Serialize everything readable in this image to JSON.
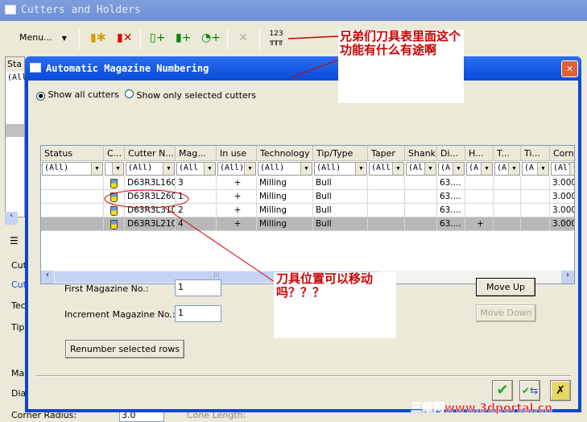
{
  "main_window": {
    "title": "Cutters and Holders",
    "menu_label": "Menu...",
    "toolbar_icons": [
      "new-cutter-icon",
      "delete-cutter-icon",
      "add-cutter-icon",
      "add-multi-cutter-icon",
      "add-holder-icon",
      "clear-filter-icon",
      "magazine-numbering-icon"
    ],
    "behind": {
      "status_header": "Sta",
      "filter": "(All",
      "labels": [
        "Cut",
        "Cut",
        "Tec",
        "Tip",
        "Ma",
        "Dia"
      ],
      "corner_radius_label": "Corner Radius:",
      "corner_radius_value": "3.0",
      "cone_length_label": "Cone Length:"
    }
  },
  "dialog": {
    "title": "Automatic Magazine Numbering",
    "radio": {
      "options": [
        "Show all cutters",
        "Show only selected cutters"
      ],
      "selected": 0
    },
    "grid": {
      "columns": [
        "Status",
        "C...",
        "Cutter N...",
        "Mag...",
        "In use",
        "Technology",
        "Tip/Type",
        "Taper",
        "Shank",
        "Di...",
        "H...",
        "T...",
        "Ti...",
        "Corn"
      ],
      "filters": [
        "(All)",
        "",
        "(All)",
        "(All",
        "(All)",
        "(All)",
        "(All)",
        "(All",
        "(Al",
        "(A",
        "(A",
        "(A",
        "(A",
        "(All"
      ],
      "rows": [
        [
          "",
          "",
          "D63R3L160",
          "3",
          "+",
          "Milling",
          "Bull",
          "",
          "",
          "63....",
          "",
          "",
          "",
          "3.000"
        ],
        [
          "",
          "",
          "D63R3L260",
          "1",
          "+",
          "Milling",
          "Bull",
          "",
          "",
          "63....",
          "",
          "",
          "",
          "3.000"
        ],
        [
          "",
          "",
          "D63R3L310",
          "2",
          "+",
          "Milling",
          "Bull",
          "",
          "",
          "63....",
          "",
          "",
          "",
          "3.000"
        ],
        [
          "",
          "",
          "D63R3L210",
          "4",
          "+",
          "Milling",
          "Bull",
          "",
          "",
          "63....",
          "+",
          "",
          "",
          "3.000"
        ]
      ],
      "selected_row": 3
    },
    "first_magazine_label": "First Magazine No.:",
    "first_magazine_value": "1",
    "increment_label": "Increment Magazine No.:",
    "increment_value": "1",
    "renumber_button": "Renumber selected rows",
    "move_up": "Move Up",
    "move_down": "Move Down",
    "footer_icons": [
      "ok-check-icon",
      "apply-icon",
      "cancel-icon"
    ]
  },
  "annotations": {
    "note1": "兄弟们刀具表里面这个功能有什么有途啊",
    "note2": "刀具位置可以移动吗？？？",
    "watermark": "三维网www.3dportal.cn",
    "color": "#cc0000"
  }
}
